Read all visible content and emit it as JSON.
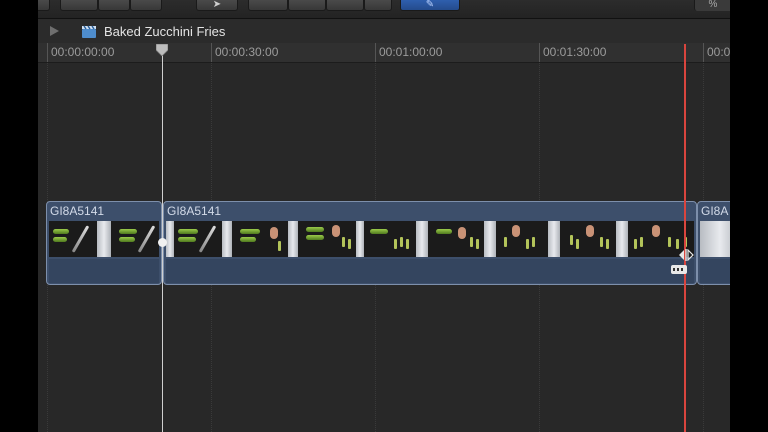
{
  "project": {
    "title": "Baked Zucchini Fries"
  },
  "ruler": {
    "labels": [
      "00:00:00:00",
      "00:00:30:00",
      "00:01:00:00",
      "00:01:30:00",
      "00:0"
    ]
  },
  "clips": [
    {
      "name": "GI8A5141"
    },
    {
      "name": "GI8A5141"
    },
    {
      "name": "GI8A"
    }
  ],
  "toolbar": {
    "right_text": "%"
  },
  "colors": {
    "clip_fill": "#3d4f6b",
    "clip_border": "#7d8fab",
    "skimmer": "#d9453e",
    "playhead": "#cfcfcf"
  },
  "icons": [
    "play-icon",
    "clapperboard-icon",
    "playhead-icon",
    "trim-icon",
    "connection-icon"
  ]
}
